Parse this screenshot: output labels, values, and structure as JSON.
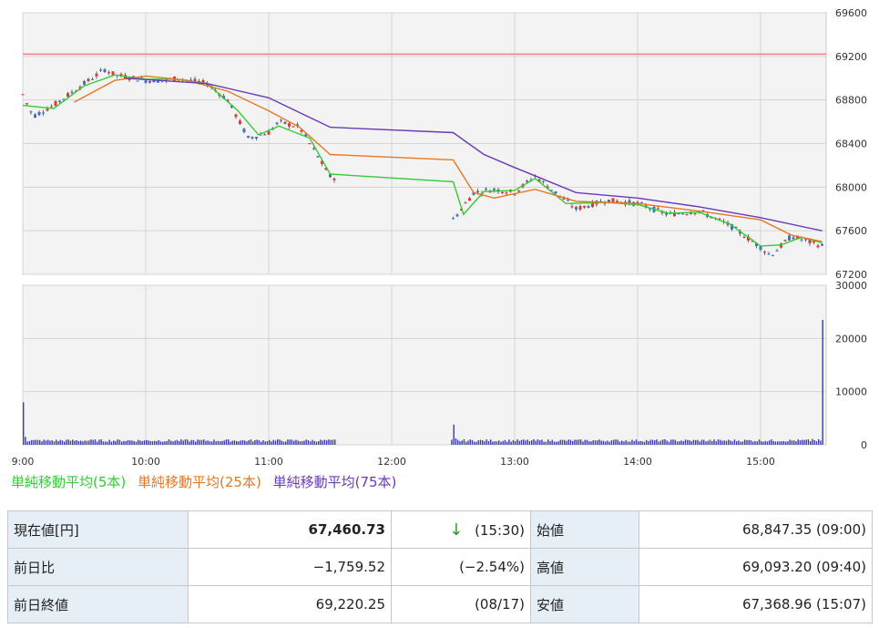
{
  "chart_data": [
    {
      "type": "candlestick",
      "y_ticks": [
        "69600",
        "69200",
        "68800",
        "68400",
        "68000",
        "67600",
        "67200"
      ],
      "x_ticks": [
        "9:00",
        "10:00",
        "11:00",
        "12:00",
        "13:00",
        "14:00",
        "15:00"
      ],
      "reference_line": {
        "value": 69220.25,
        "color": "#f08080"
      },
      "price_path": [
        [
          "9:00",
          68850
        ],
        [
          "9:05",
          68650
        ],
        [
          "9:15",
          68750
        ],
        [
          "9:30",
          68950
        ],
        [
          "9:40",
          69080
        ],
        [
          "9:45",
          69030
        ],
        [
          "10:00",
          68980
        ],
        [
          "10:10",
          68980
        ],
        [
          "10:15",
          69000
        ],
        [
          "10:30",
          68950
        ],
        [
          "10:40",
          68800
        ],
        [
          "10:50",
          68450
        ],
        [
          "11:00",
          68500
        ],
        [
          "11:05",
          68600
        ],
        [
          "11:15",
          68550
        ],
        [
          "11:30",
          68100
        ],
        [
          "12:30",
          67700
        ],
        [
          "12:40",
          67950
        ],
        [
          "12:50",
          67980
        ],
        [
          "13:00",
          67950
        ],
        [
          "13:10",
          68100
        ],
        [
          "13:20",
          67950
        ],
        [
          "13:30",
          67800
        ],
        [
          "13:45",
          67880
        ],
        [
          "14:00",
          67850
        ],
        [
          "14:15",
          67750
        ],
        [
          "14:30",
          67780
        ],
        [
          "14:45",
          67650
        ],
        [
          "15:00",
          67450
        ],
        [
          "15:05",
          67370
        ],
        [
          "15:15",
          67550
        ],
        [
          "15:30",
          67460
        ]
      ],
      "series": [
        {
          "name": "単純移動平均(5本)",
          "color": "#33cc33",
          "points": [
            [
              "9:00",
              68750
            ],
            [
              "9:15",
              68720
            ],
            [
              "9:30",
              68930
            ],
            [
              "9:45",
              69030
            ],
            [
              "10:00",
              68990
            ],
            [
              "10:15",
              68990
            ],
            [
              "10:30",
              68950
            ],
            [
              "10:45",
              68700
            ],
            [
              "10:55",
              68480
            ],
            [
              "11:05",
              68560
            ],
            [
              "11:20",
              68450
            ],
            [
              "11:30",
              68120
            ],
            [
              "12:30",
              68050
            ],
            [
              "12:35",
              67750
            ],
            [
              "12:45",
              67960
            ],
            [
              "13:00",
              67970
            ],
            [
              "13:10",
              68080
            ],
            [
              "13:25",
              67850
            ],
            [
              "13:45",
              67860
            ],
            [
              "14:00",
              67840
            ],
            [
              "14:15",
              67760
            ],
            [
              "14:30",
              67770
            ],
            [
              "14:45",
              67660
            ],
            [
              "15:00",
              67460
            ],
            [
              "15:10",
              67470
            ],
            [
              "15:20",
              67540
            ],
            [
              "15:30",
              67490
            ]
          ]
        },
        {
          "name": "単純移動平均(25本)",
          "color": "#e87722",
          "points": [
            [
              "9:25",
              68780
            ],
            [
              "9:45",
              68980
            ],
            [
              "10:00",
              69020
            ],
            [
              "10:20",
              68980
            ],
            [
              "10:40",
              68880
            ],
            [
              "11:00",
              68700
            ],
            [
              "11:15",
              68550
            ],
            [
              "11:30",
              68300
            ],
            [
              "12:30",
              68250
            ],
            [
              "12:40",
              67950
            ],
            [
              "12:50",
              67900
            ],
            [
              "13:10",
              67980
            ],
            [
              "13:30",
              67870
            ],
            [
              "14:00",
              67850
            ],
            [
              "14:30",
              67780
            ],
            [
              "15:00",
              67700
            ],
            [
              "15:15",
              67560
            ],
            [
              "15:30",
              67500
            ]
          ]
        },
        {
          "name": "単純移動平均(75本)",
          "color": "#6a39b8",
          "points": [
            [
              "9:50",
              69000
            ],
            [
              "10:30",
              68950
            ],
            [
              "11:00",
              68820
            ],
            [
              "11:30",
              68550
            ],
            [
              "12:30",
              68500
            ],
            [
              "12:45",
              68300
            ],
            [
              "13:00",
              68180
            ],
            [
              "13:30",
              67950
            ],
            [
              "14:00",
              67900
            ],
            [
              "14:30",
              67820
            ],
            [
              "15:00",
              67720
            ],
            [
              "15:30",
              67600
            ]
          ]
        }
      ]
    },
    {
      "type": "bar",
      "y_ticks": [
        "30000",
        "20000",
        "10000",
        "0"
      ],
      "ylim": [
        0,
        30000
      ],
      "x_ticks": [
        "9:00",
        "10:00",
        "11:00",
        "12:00",
        "13:00",
        "14:00",
        "15:00"
      ],
      "series": [
        {
          "name": "",
          "color": "#3b3bb0",
          "values": [
            [
              "9:00",
              8000
            ],
            [
              "9:01",
              1500
            ],
            [
              "11:30",
              900
            ],
            [
              "12:30",
              3800
            ],
            [
              "12:31",
              1200
            ],
            [
              "15:25",
              1100
            ],
            [
              "15:30",
              23500
            ]
          ],
          "typical_value": 800
        }
      ]
    }
  ],
  "legend": [
    {
      "label": "単純移動平均(5本)",
      "color": "#33cc33"
    },
    {
      "label": "単純移動平均(25本)",
      "color": "#e87722"
    },
    {
      "label": "単純移動平均(75本)",
      "color": "#6a39b8"
    }
  ],
  "quote": {
    "current_label": "現在値[円]",
    "current_value": "67,460.73",
    "arrow": "↓",
    "current_time": "(15:30)",
    "open_label": "始値",
    "open_value": "68,847.35 (09:00)",
    "change_label": "前日比",
    "change_value": "−1,759.52",
    "change_pct": "(−2.54%)",
    "high_label": "高値",
    "high_value": "69,093.20 (09:40)",
    "prev_close_label": "前日終値",
    "prev_close_value": "69,220.25",
    "prev_close_date": "(08/17)",
    "low_label": "安値",
    "low_value": "67,368.96 (15:07)"
  }
}
